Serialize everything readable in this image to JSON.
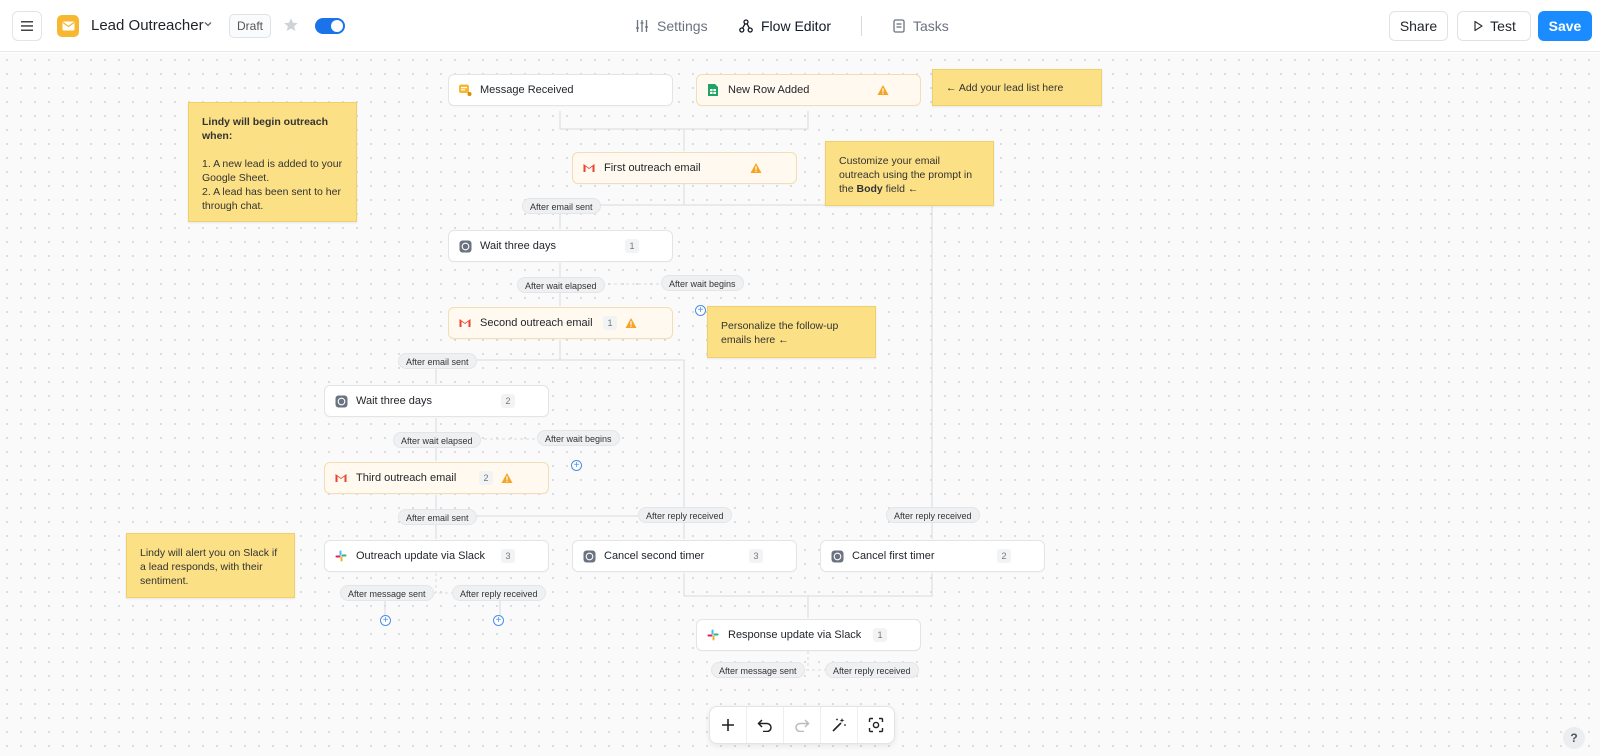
{
  "header": {
    "app_title": "Lead Outreacher",
    "status_badge": "Draft",
    "tabs": [
      {
        "label": "Settings"
      },
      {
        "label": "Flow Editor"
      },
      {
        "label": "Tasks"
      }
    ],
    "share_label": "Share",
    "test_label": "Test",
    "save_label": "Save",
    "accent_color": "#1a8cff"
  },
  "nodes": {
    "message_received": {
      "label": "Message Received"
    },
    "new_row_added": {
      "label": "New Row Added"
    },
    "first_outreach": {
      "label": "First outreach email"
    },
    "wait_1": {
      "label": "Wait three days",
      "count": "1"
    },
    "second_outreach": {
      "label": "Second outreach email",
      "count": "1"
    },
    "wait_2": {
      "label": "Wait three days",
      "count": "2"
    },
    "third_outreach": {
      "label": "Third outreach email",
      "count": "2"
    },
    "outreach_slack": {
      "label": "Outreach update via Slack",
      "count": "3"
    },
    "cancel_second": {
      "label": "Cancel second timer",
      "count": "3"
    },
    "cancel_first": {
      "label": "Cancel first timer",
      "count": "2"
    },
    "response_slack": {
      "label": "Response update via Slack",
      "count": "1"
    }
  },
  "edge_labels": {
    "after_email_sent_1": "After email sent",
    "after_wait_elapsed_1": "After wait elapsed",
    "after_wait_begins_1": "After wait begins",
    "after_email_sent_2": "After email sent",
    "after_wait_elapsed_2": "After wait elapsed",
    "after_wait_begins_2": "After wait begins",
    "after_email_sent_3": "After email sent",
    "after_reply_received_1": "After reply received",
    "after_reply_received_2": "After reply received",
    "after_message_sent_1": "After message sent",
    "after_reply_received_3": "After reply received",
    "after_message_sent_2": "After message sent",
    "after_reply_received_4": "After reply received"
  },
  "notes": {
    "lead_list": "← Add your lead list here",
    "begin_title": "Lindy will begin outreach when:",
    "begin_item_1": "1. A new lead is added to your Google Sheet.",
    "begin_item_2": "2. A lead has been sent to her through chat.",
    "customize_pre": "Customize your email outreach using the prompt in the ",
    "customize_bold": "Body",
    "customize_post": " field ←",
    "personalize": "Personalize the follow-up emails here ←",
    "slack_alert": "Lindy will alert you on Slack if a lead responds, with their sentiment."
  },
  "help_label": "?"
}
